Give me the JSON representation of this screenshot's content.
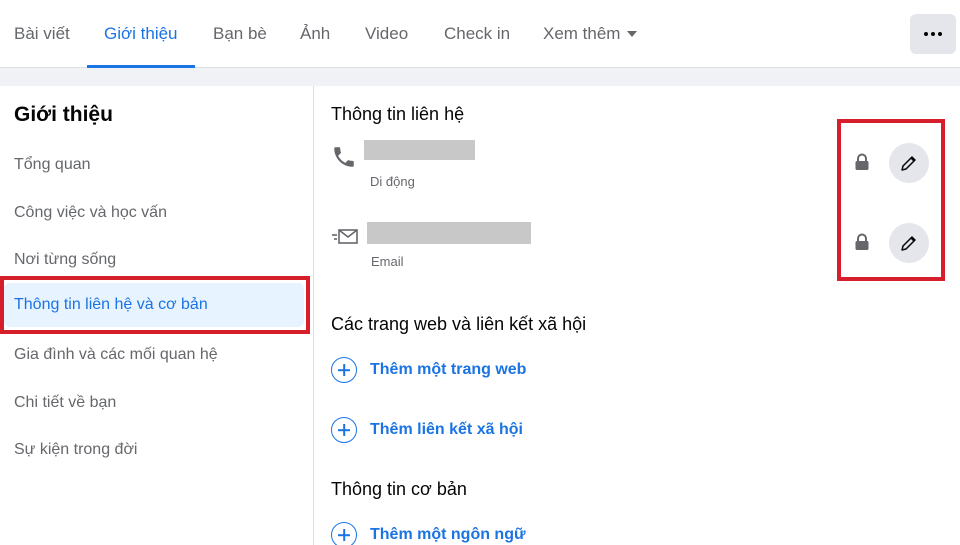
{
  "tabs": [
    {
      "label": "Bài viết",
      "active": false
    },
    {
      "label": "Giới thiệu",
      "active": true
    },
    {
      "label": "Bạn bè",
      "active": false
    },
    {
      "label": "Ảnh",
      "active": false
    },
    {
      "label": "Video",
      "active": false
    },
    {
      "label": "Check in",
      "active": false
    },
    {
      "label": "Xem thêm",
      "active": false
    }
  ],
  "more_menu_icon": "ellipsis-icon",
  "sidebar": {
    "title": "Giới thiệu",
    "items": [
      {
        "label": "Tổng quan"
      },
      {
        "label": "Công việc và học vấn"
      },
      {
        "label": "Nơi từng sống"
      },
      {
        "label": "Thông tin liên hệ và cơ bản",
        "selected": true
      },
      {
        "label": "Gia đình và các mối quan hệ"
      },
      {
        "label": "Chi tiết về bạn"
      },
      {
        "label": "Sự kiện trong đời"
      }
    ]
  },
  "contact": {
    "title": "Thông tin liên hệ",
    "phone": {
      "icon": "phone-icon",
      "sublabel": "Di động",
      "privacy_icon": "lock-icon",
      "edit_icon": "pencil-icon"
    },
    "email": {
      "icon": "envelope-icon",
      "sublabel": "Email",
      "privacy_icon": "lock-icon",
      "edit_icon": "pencil-icon"
    }
  },
  "websites": {
    "title": "Các trang web và liên kết xã hội",
    "add_website": "Thêm một trang web",
    "add_social": "Thêm liên kết xã hội"
  },
  "basic": {
    "title": "Thông tin cơ bản",
    "add_language": "Thêm một ngôn ngữ"
  },
  "colors": {
    "accent": "#1b74e4",
    "highlight_border": "#d5202c",
    "selected_bg": "#e7f3ff"
  }
}
